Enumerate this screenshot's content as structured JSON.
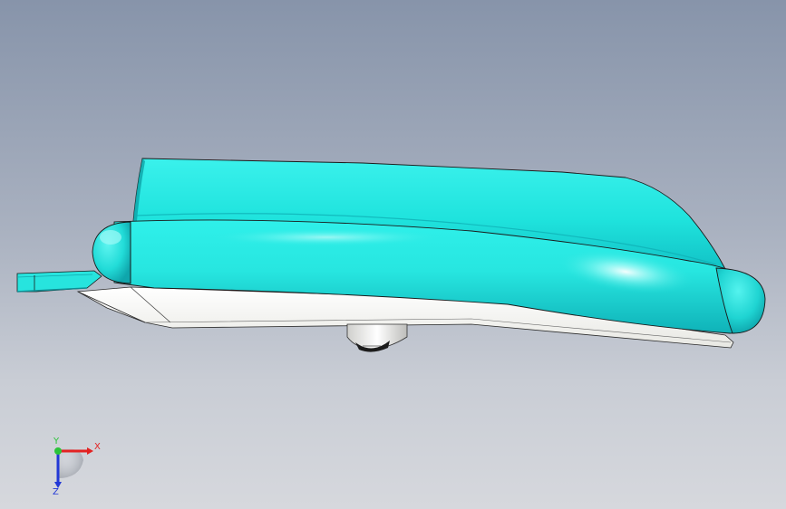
{
  "viewport": {
    "model": {
      "body_color": "#1fe8e0",
      "body_shadow_color": "#10b4b8",
      "base_color": "#f4f4f2",
      "edge_color": "#1a1a1a"
    }
  },
  "triad": {
    "x_label": "X",
    "y_label": "Y",
    "z_label": "Z",
    "x_color": "#e32222",
    "y_color": "#2bc43a",
    "z_color": "#2238d6"
  }
}
